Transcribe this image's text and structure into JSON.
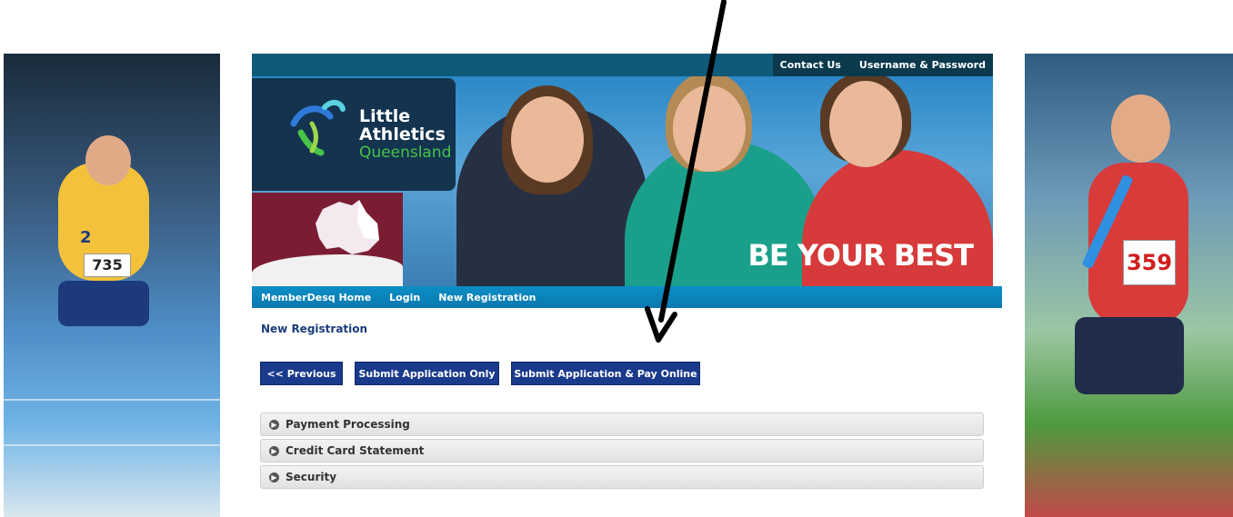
{
  "header": {
    "top_links": [
      {
        "label": "Contact Us"
      },
      {
        "label": "Username & Password"
      }
    ]
  },
  "banner": {
    "logo_line1": "Little",
    "logo_line2": "Athletics",
    "logo_line3": "Queensland",
    "slogan": "BE YOUR BEST"
  },
  "nav": {
    "items": [
      {
        "label": "MemberDesq Home"
      },
      {
        "label": "Login"
      },
      {
        "label": "New Registration"
      }
    ]
  },
  "page": {
    "title": "New Registration"
  },
  "buttons": {
    "previous": "<< Previous",
    "submit_only": "Submit Application Only",
    "submit_pay": "Submit Application & Pay Online"
  },
  "panels": [
    {
      "label": "Payment Processing"
    },
    {
      "label": "Credit Card Statement"
    },
    {
      "label": "Security"
    }
  ],
  "side_photos": {
    "left_bib": "735",
    "left_number": "2",
    "right_bib": "359"
  },
  "colors": {
    "nav_blue": "#0a86bd",
    "button_blue": "#1a3a8c",
    "logo_green": "#48c34a",
    "dark_navy": "#13334f"
  },
  "icons": {
    "panel_icon": "circle-arrow-right-icon",
    "annotation": "arrow-down-icon"
  }
}
